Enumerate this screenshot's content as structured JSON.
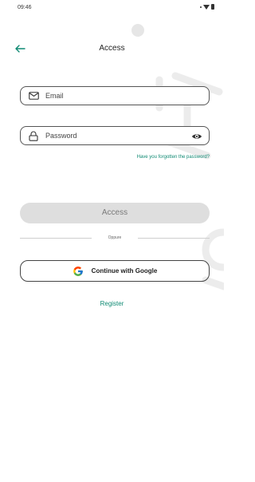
{
  "status_bar": {
    "time": "09:46"
  },
  "header": {
    "title": "Access"
  },
  "login_form": {
    "email_placeholder": "Email",
    "password_placeholder": "Password",
    "forgot_password": "Have you forgotten the password?",
    "access_button": "Access",
    "divider_text": "Oppure",
    "google_button": "Continue with Google",
    "register_link": "Register"
  },
  "colors": {
    "accent": "#0f8a73",
    "disabled_button": "#dedede",
    "google_blue": "#4285F4",
    "google_red": "#EA4335",
    "google_yellow": "#FBBC05",
    "google_green": "#34A853"
  },
  "icons": {
    "back": "arrow-left-icon",
    "email": "envelope-icon",
    "password": "lock-icon",
    "visibility": "eye-icon",
    "google": "google-icon"
  }
}
